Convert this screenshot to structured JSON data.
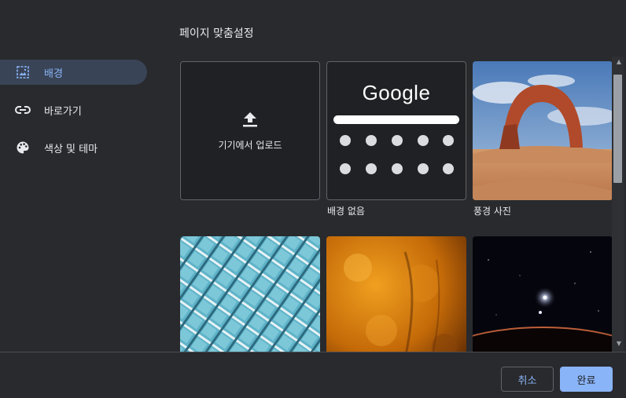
{
  "dialog": {
    "title": "페이지 맞춤설정"
  },
  "sidebar": {
    "items": [
      {
        "label": "배경",
        "icon": "image-icon",
        "active": true
      },
      {
        "label": "바로가기",
        "icon": "link-icon",
        "active": false
      },
      {
        "label": "색상 및 테마",
        "icon": "palette-icon",
        "active": false
      }
    ]
  },
  "backgrounds": {
    "upload_label": "기기에서 업로드",
    "no_background": {
      "logo": "Google",
      "label": "배경 없음"
    },
    "landscape": {
      "label": "풍경 사진"
    }
  },
  "footer": {
    "cancel_label": "취소",
    "done_label": "완료"
  },
  "colors": {
    "accent": "#8ab4f8",
    "background": "#292a2d",
    "active_nav": "#394457"
  }
}
